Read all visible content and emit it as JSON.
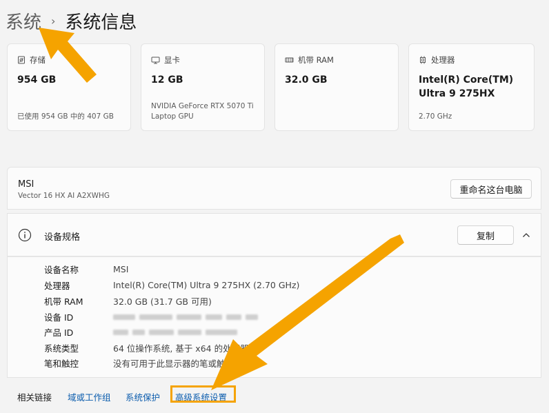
{
  "breadcrumb": {
    "parent": "系统",
    "separator": "›",
    "current": "系统信息"
  },
  "cards": [
    {
      "icon": "storage-icon",
      "label": "存储",
      "value": "954 GB",
      "sub": "已使用 954 GB 中的 407 GB"
    },
    {
      "icon": "gpu-icon",
      "label": "显卡",
      "value": "12 GB",
      "sub": "NVIDIA GeForce RTX 5070 Ti Laptop GPU"
    },
    {
      "icon": "ram-icon",
      "label": "机带 RAM",
      "value": "32.0 GB",
      "sub": ""
    },
    {
      "icon": "cpu-icon",
      "label": "处理器",
      "value": "Intel(R) Core(TM) Ultra 9 275HX",
      "sub": "2.70 GHz"
    }
  ],
  "device": {
    "name": "MSI",
    "model": "Vector 16 HX AI A2XWHG",
    "rename_button": "重命名这台电脑"
  },
  "specs": {
    "title": "设备规格",
    "copy_button": "复制",
    "rows": [
      {
        "key": "设备名称",
        "value": "MSI"
      },
      {
        "key": "处理器",
        "value": "Intel(R) Core(TM) Ultra 9 275HX (2.70 GHz)"
      },
      {
        "key": "机带 RAM",
        "value": "32.0 GB (31.7 GB 可用)"
      },
      {
        "key": "设备 ID",
        "value": ""
      },
      {
        "key": "产品 ID",
        "value": ""
      },
      {
        "key": "系统类型",
        "value": "64 位操作系统, 基于 x64 的处理器"
      },
      {
        "key": "笔和触控",
        "value": "没有可用于此显示器的笔或触控输入"
      }
    ]
  },
  "related": {
    "label": "相关链接",
    "links": [
      "域或工作组",
      "系统保护",
      "高级系统设置"
    ]
  },
  "colors": {
    "accent": "#0b5cad",
    "arrow": "#f5a300",
    "highlight_box": "#f5a300"
  }
}
